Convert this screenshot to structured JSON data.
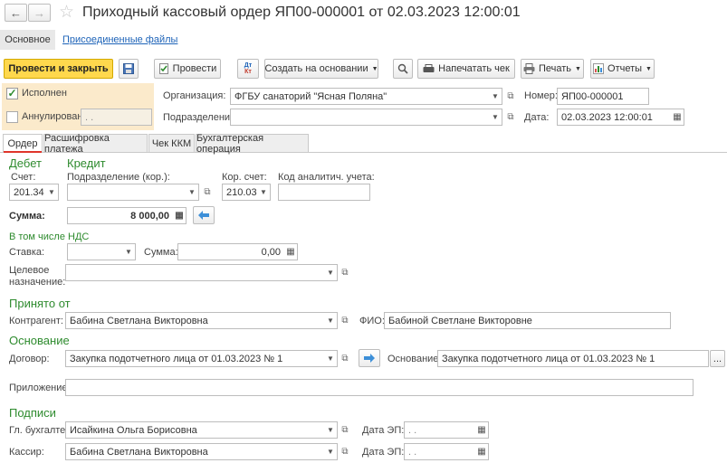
{
  "window": {
    "title": "Приходный кассовый ордер ЯП00-000001 от 02.03.2023 12:00:01"
  },
  "topTabs": [
    {
      "label": "Основное"
    },
    {
      "label": "Присоединенные файлы"
    }
  ],
  "toolbar": {
    "post_close": "Провести и закрыть",
    "post": "Провести",
    "create_based": "Создать на основании",
    "print_check": "Напечатать чек",
    "print": "Печать",
    "reports": "Отчеты"
  },
  "status": {
    "executed": {
      "label": "Исполнен",
      "checked": true
    },
    "cancelled": {
      "label": "Аннулирован",
      "checked": false,
      "date": ". ."
    }
  },
  "org": {
    "org_label": "Организация:",
    "org_value": "ФГБУ санаторий \"Ясная Поляна\"",
    "dept_label": "Подразделение:",
    "dept_value": "",
    "number_label": "Номер:",
    "number_value": "ЯП00-000001",
    "date_label": "Дата:",
    "date_value": "02.03.2023 12:00:01"
  },
  "docTabs": [
    {
      "label": "Ордер"
    },
    {
      "label": "Расшифровка платежа"
    },
    {
      "label": "Чек ККМ"
    },
    {
      "label": "Бухгалтерская операция"
    }
  ],
  "debit": {
    "title": "Дебет",
    "account_label": "Счет:",
    "account_value": "201.34"
  },
  "credit": {
    "title": "Кредит",
    "dept_label": "Подразделение (кор.):",
    "dept_value": "",
    "cor_account_label": "Кор. счет:",
    "cor_account_value": "210.03",
    "analytic_label": "Код аналитич. учета:",
    "analytic_value": ""
  },
  "amount": {
    "label": "Сумма:",
    "value": "8 000,00"
  },
  "vat": {
    "title": "В том числе НДС",
    "rate_label": "Ставка:",
    "rate_value": "",
    "sum_label": "Сумма:",
    "sum_value": "0,00"
  },
  "purpose": {
    "label_line1": "Целевое",
    "label_line2": "назначение:",
    "value": ""
  },
  "received": {
    "title": "Принято от",
    "counterparty_label": "Контрагент:",
    "counterparty_value": "Бабина Светлана Викторовна",
    "fio_label": "ФИО:",
    "fio_value": "Бабиной Светлане Викторовне"
  },
  "basis": {
    "title": "Основание",
    "contract_label": "Договор:",
    "contract_value": "Закупка подотчетного лица от 01.03.2023 № 1",
    "basis_label": "Основание:",
    "basis_value": "Закупка подотчетного лица от 01.03.2023 № 1",
    "attachment_label": "Приложение:",
    "attachment_value": ""
  },
  "signatures": {
    "title": "Подписи",
    "chief_label": "Гл. бухгалтер:",
    "chief_value": "Исайкина Ольга Борисовна",
    "cashier_label": "Кассир:",
    "cashier_value": "Бабина Светлана Викторовна",
    "date_ep_label": "Дата ЭП:",
    "date_ep_value1": ". .",
    "date_ep_value2": ". ."
  },
  "colors": {
    "accent_yellow": "#ffd84d",
    "status_bg": "#fbeacb",
    "green": "#2e8b2e",
    "link": "#1d63b8",
    "arrow_blue": "#3c8fd8"
  }
}
